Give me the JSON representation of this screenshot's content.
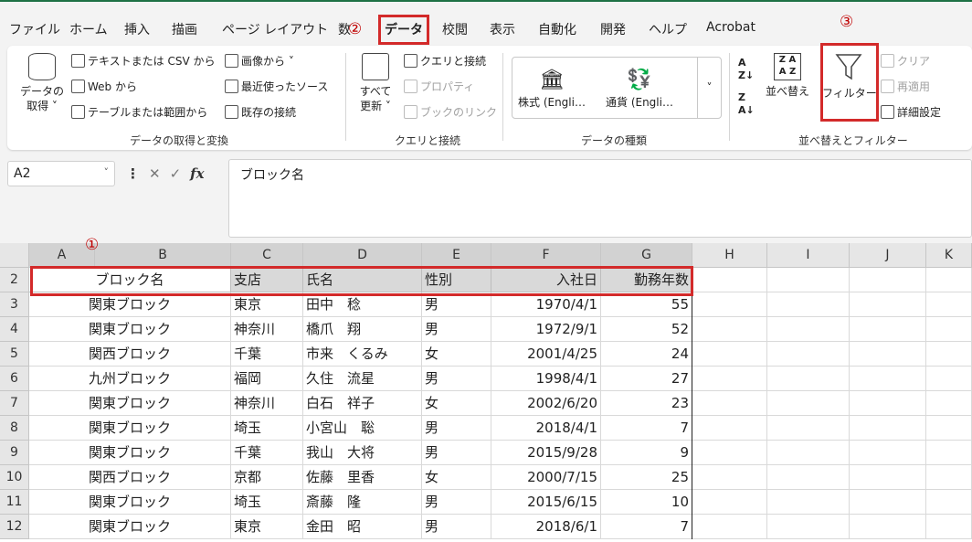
{
  "ribbon_tabs": [
    "ファイル",
    "ホーム",
    "挿入",
    "描画",
    "ページ レイアウト",
    "数",
    "データ",
    "校閲",
    "表示",
    "自動化",
    "開発",
    "ヘルプ",
    "Acrobat"
  ],
  "active_tab": "データ",
  "ribbon": {
    "get_data": {
      "big_button": "データの\n取得 ˅",
      "items": [
        "テキストまたは CSV から",
        "Web から",
        "テーブルまたは範囲から",
        "画像から ˅",
        "最近使ったソース",
        "既存の接続"
      ],
      "group_label": "データの取得と変換"
    },
    "queries": {
      "big_button": "すべて\n更新 ˅",
      "items": [
        "クエリと接続",
        "プロパティ",
        "ブックのリンク"
      ],
      "group_label": "クエリと接続"
    },
    "data_types": {
      "items": [
        "株式 (Engli…",
        "通貨 (Engli…"
      ],
      "group_label": "データの種類"
    },
    "sort_filter": {
      "sort_label": "並べ替え",
      "filter_label": "フィルター",
      "clear_label": "クリア",
      "reapply_label": "再適用",
      "advanced_label": "詳細設定",
      "group_label": "並べ替えとフィルター"
    }
  },
  "annotations": [
    "①",
    "②",
    "③"
  ],
  "formula_bar": {
    "name_box": "A2",
    "fx": "fx",
    "content": "ブロック名"
  },
  "columns": [
    "A",
    "B",
    "C",
    "D",
    "E",
    "F",
    "G",
    "H",
    "I",
    "J",
    "K"
  ],
  "rows": [
    "2",
    "3",
    "4",
    "5",
    "6",
    "7",
    "8",
    "9",
    "10",
    "11",
    "12"
  ],
  "table": {
    "headers": [
      "ブロック名",
      "支店",
      "氏名",
      "性別",
      "入社日",
      "勤務年数"
    ],
    "data": [
      [
        "関東ブロック",
        "東京",
        "田中　稔",
        "男",
        "1970/4/1",
        "55"
      ],
      [
        "関東ブロック",
        "神奈川",
        "橋爪　翔",
        "男",
        "1972/9/1",
        "52"
      ],
      [
        "関西ブロック",
        "千葉",
        "市来　くるみ",
        "女",
        "2001/4/25",
        "24"
      ],
      [
        "九州ブロック",
        "福岡",
        "久住　流星",
        "男",
        "1998/4/1",
        "27"
      ],
      [
        "関東ブロック",
        "神奈川",
        "白石　祥子",
        "女",
        "2002/6/20",
        "23"
      ],
      [
        "関東ブロック",
        "埼玉",
        "小宮山　聡",
        "男",
        "2018/4/1",
        "7"
      ],
      [
        "関東ブロック",
        "千葉",
        "我山　大将",
        "男",
        "2015/9/28",
        "9"
      ],
      [
        "関西ブロック",
        "京都",
        "佐藤　里香",
        "女",
        "2000/7/15",
        "25"
      ],
      [
        "関東ブロック",
        "埼玉",
        "斎藤　隆",
        "男",
        "2015/6/15",
        "10"
      ],
      [
        "関東ブロック",
        "東京",
        "金田　昭",
        "男",
        "2018/6/1",
        "7"
      ]
    ]
  },
  "colors": {
    "highlight": "#d32a2a",
    "annotation": "#c00000",
    "excel_green": "#1e7145"
  }
}
